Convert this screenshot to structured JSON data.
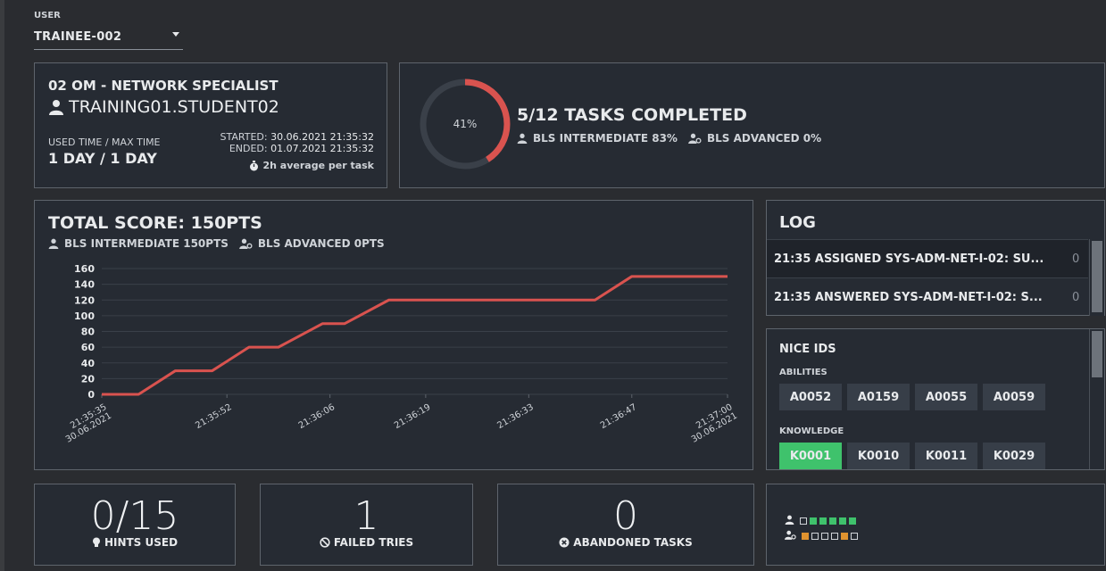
{
  "user": {
    "label": "USER",
    "value": "TRAINEE-002"
  },
  "info": {
    "role": "02 OM - NETWORK SPECIALIST",
    "student": "TRAINING01.STUDENT02",
    "used_label": "USED TIME / MAX TIME",
    "used_value": "1 DAY / 1 DAY",
    "started_label": "STARTED:",
    "started_value": "30.06.2021 21:35:32",
    "ended_label": "ENDED:",
    "ended_value": "01.07.2021 21:35:32",
    "average": "2h average per task"
  },
  "progress": {
    "percent_text": "41%",
    "percent": 41,
    "tasks": "5/12 TASKS COMPLETED",
    "intermediate": "BLS INTERMEDIATE 83%",
    "advanced": "BLS ADVANCED 0%"
  },
  "score": {
    "title": "TOTAL SCORE: 150PTS",
    "intermediate": "BLS INTERMEDIATE 150PTS",
    "advanced": "BLS ADVANCED 0PTS"
  },
  "chart_data": {
    "type": "line",
    "title": "",
    "xlabel": "",
    "ylabel": "",
    "ylim": [
      0,
      160
    ],
    "yticks": [
      0,
      20,
      40,
      60,
      80,
      100,
      120,
      140,
      160
    ],
    "xtick_labels": [
      [
        "21:35:35",
        "30.06.2021"
      ],
      [
        "21:35:52"
      ],
      [
        "21:36:06"
      ],
      [
        "21:36:19"
      ],
      [
        "21:36:33"
      ],
      [
        "21:36:47"
      ],
      [
        "21:37:00",
        "30.06.2021"
      ]
    ],
    "x": [
      "21:35:35",
      "21:35:40",
      "21:35:45",
      "21:35:50",
      "21:35:55",
      "21:35:59",
      "21:36:05",
      "21:36:08",
      "21:36:14",
      "21:36:18",
      "21:36:24",
      "21:36:31",
      "21:36:42",
      "21:36:47",
      "21:36:53",
      "21:37:00"
    ],
    "series": [
      {
        "values": [
          0,
          0,
          30,
          30,
          60,
          60,
          90,
          90,
          120,
          120,
          120,
          120,
          120,
          150,
          150,
          150
        ],
        "color": "#d9534f"
      }
    ]
  },
  "log": {
    "title": "LOG",
    "rows": [
      {
        "text": "21:35  ASSIGNED SYS-ADM-NET-I-02: SU...",
        "count": "0"
      },
      {
        "text": "21:35  ANSWERED SYS-ADM-NET-I-02: S...",
        "count": "0"
      }
    ]
  },
  "nice": {
    "title": "NICE IDS",
    "abilities_label": "ABILITIES",
    "abilities": [
      "A0052",
      "A0159",
      "A0055",
      "A0059"
    ],
    "knowledge_label": "KNOWLEDGE",
    "knowledge": [
      "K0001",
      "K0010",
      "K0011",
      "K0029"
    ],
    "active_knowledge": "K0001"
  },
  "stats": {
    "hints_value": "0/15",
    "hints_label": "HINTS USED",
    "failed_value": "1",
    "failed_label": "FAILED TRIES",
    "abandoned_value": "0",
    "abandoned_label": "ABANDONED TASKS"
  },
  "tracks": {
    "intermediate": [
      "empty",
      "green",
      "green",
      "green",
      "green",
      "green"
    ],
    "advanced": [
      "orange",
      "empty",
      "empty",
      "empty",
      "orange",
      "empty"
    ]
  },
  "colors": {
    "accent": "#d9534f",
    "green": "#3fc26c",
    "orange": "#e0932f",
    "panel": "#262b33",
    "border": "#5e646c"
  }
}
